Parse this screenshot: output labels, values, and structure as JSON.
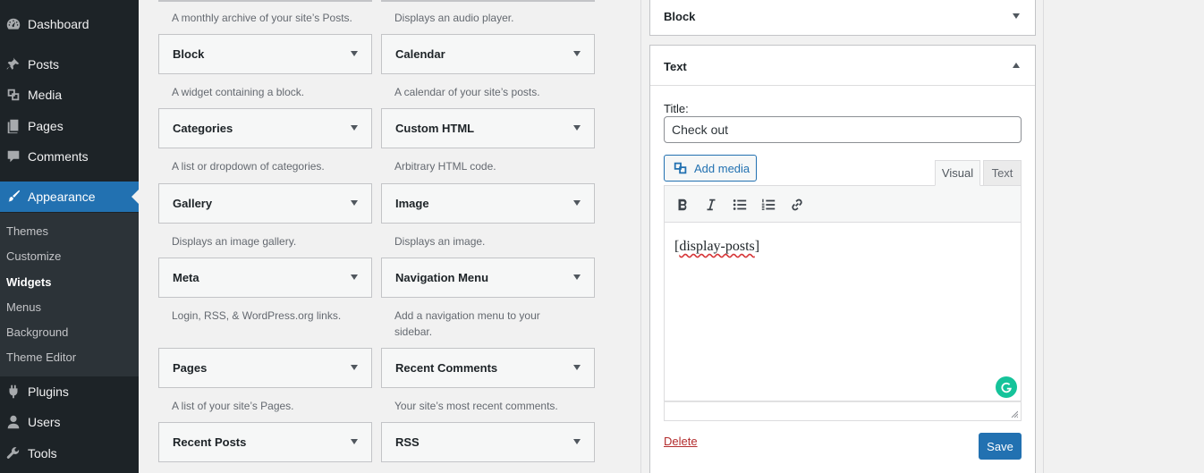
{
  "sidebar": {
    "items": [
      {
        "label": "Dashboard",
        "icon": "dashboard-icon"
      },
      {
        "label": "Posts",
        "icon": "pin-icon"
      },
      {
        "label": "Media",
        "icon": "media-icon"
      },
      {
        "label": "Pages",
        "icon": "pages-icon"
      },
      {
        "label": "Comments",
        "icon": "comment-icon"
      },
      {
        "label": "Appearance",
        "icon": "paintbrush-icon",
        "current": true
      },
      {
        "label": "Plugins",
        "icon": "plugin-icon"
      },
      {
        "label": "Users",
        "icon": "user-icon"
      },
      {
        "label": "Tools",
        "icon": "wrench-icon"
      }
    ],
    "submenu": [
      {
        "label": "Themes"
      },
      {
        "label": "Customize"
      },
      {
        "label": "Widgets",
        "current": true
      },
      {
        "label": "Menus"
      },
      {
        "label": "Background"
      },
      {
        "label": "Theme Editor"
      }
    ]
  },
  "available_widgets": {
    "top_descriptions": [
      "A monthly archive of your site’s Posts.",
      "Displays an audio player."
    ],
    "widgets": [
      {
        "title": "Block",
        "description": "A widget containing a block."
      },
      {
        "title": "Calendar",
        "description": "A calendar of your site’s posts."
      },
      {
        "title": "Categories",
        "description": "A list or dropdown of categories."
      },
      {
        "title": "Custom HTML",
        "description": "Arbitrary HTML code."
      },
      {
        "title": "Gallery",
        "description": "Displays an image gallery."
      },
      {
        "title": "Image",
        "description": "Displays an image."
      },
      {
        "title": "Meta",
        "description": "Login, RSS, & WordPress.org links."
      },
      {
        "title": "Navigation Menu",
        "description": "Add a navigation menu to your sidebar."
      },
      {
        "title": "Pages",
        "description": "A list of your site’s Pages."
      },
      {
        "title": "Recent Comments",
        "description": "Your site’s most recent comments."
      },
      {
        "title": "Recent Posts",
        "description": ""
      },
      {
        "title": "RSS",
        "description": ""
      }
    ]
  },
  "sidebar_widgets": {
    "block_widget": {
      "title": "Block"
    },
    "text_widget": {
      "title": "Text",
      "title_label": "Title:",
      "title_value": "Check out",
      "add_media_label": "Add media",
      "tabs": {
        "visual": "Visual",
        "text": "Text"
      },
      "content_prefix": "[",
      "content_word": "display-posts",
      "content_suffix": "]",
      "delete_label": "Delete",
      "save_label": "Save"
    }
  },
  "colors": {
    "admin_sidebar": "#1d2327",
    "accent": "#2271b1",
    "delete": "#b32d2e",
    "grammarly": "#15c39a"
  }
}
